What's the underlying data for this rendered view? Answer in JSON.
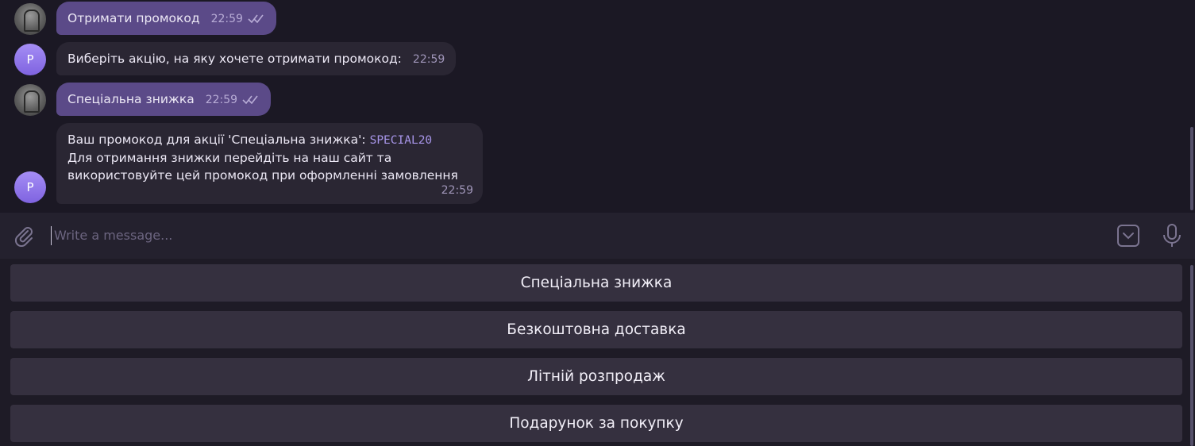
{
  "messages": [
    {
      "from": "user",
      "text": "Отримати промокод",
      "time": "22:59"
    },
    {
      "from": "bot",
      "avatar_letter": "P",
      "text": "Виберіть акцію, на яку хочете отримати промокод:",
      "time": "22:59"
    },
    {
      "from": "user",
      "text": "Спеціальна знижка",
      "time": "22:59"
    },
    {
      "from": "bot",
      "avatar_letter": "P",
      "line1_prefix": "Ваш промокод для акції 'Спеціальна знижка': ",
      "code": "SPECIAL20",
      "line2": "Для отримання знижки перейдіть на наш сайт та",
      "line3": "використовуйте цей промокод при оформленні замовлення",
      "time": "22:59"
    }
  ],
  "composer": {
    "placeholder": "Write a message..."
  },
  "keyboard": {
    "buttons": [
      "Спеціальна знижка",
      "Безкоштовна доставка",
      "Літній розпродаж",
      "Подарунок за покупку"
    ]
  },
  "colors": {
    "accent": "#8b74e6",
    "outgoing_bubble": "#5b4a88",
    "incoming_bubble": "#2a2633",
    "background": "#1b1824"
  }
}
